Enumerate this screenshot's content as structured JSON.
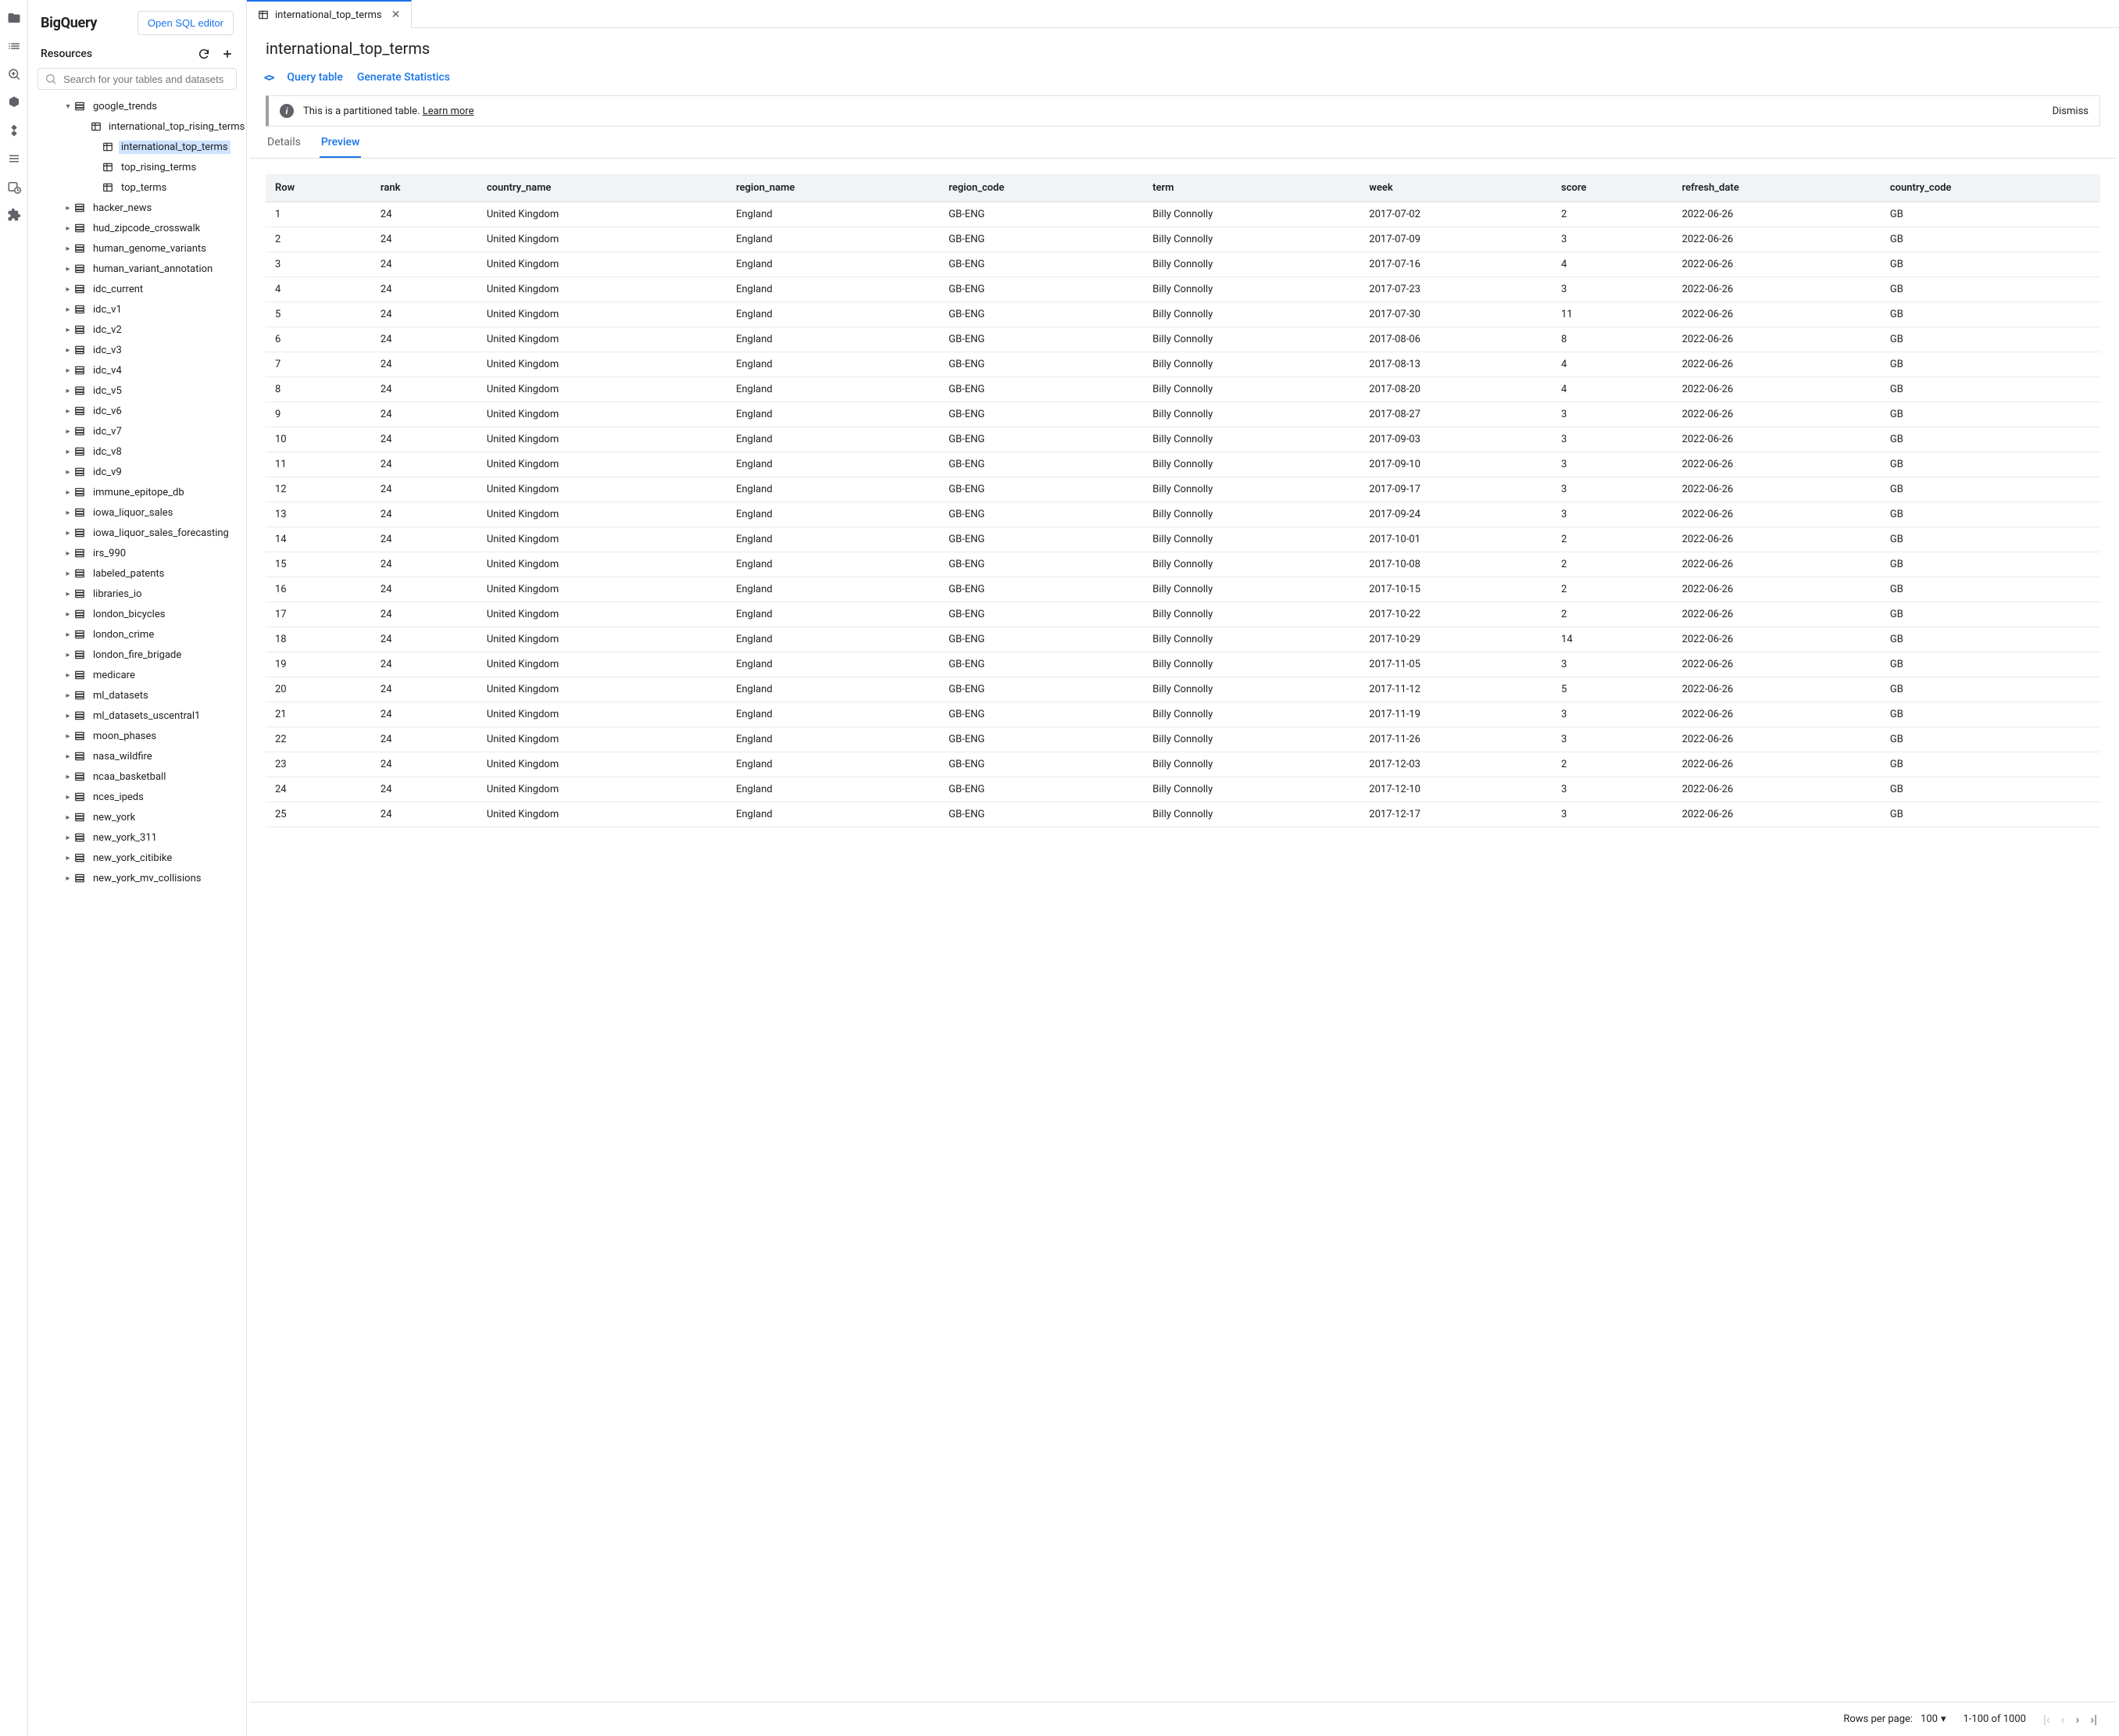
{
  "brand": "BigQuery",
  "open_editor_label": "Open SQL editor",
  "resources_label": "Resources",
  "search_placeholder": "Search for your tables and datasets",
  "tree": {
    "root": {
      "label": "google_trends",
      "expanded": true
    },
    "root_children": [
      {
        "label": "international_top_rising_terms",
        "selected": false
      },
      {
        "label": "international_top_terms",
        "selected": true
      },
      {
        "label": "top_rising_terms",
        "selected": false
      },
      {
        "label": "top_terms",
        "selected": false
      }
    ],
    "datasets": [
      "hacker_news",
      "hud_zipcode_crosswalk",
      "human_genome_variants",
      "human_variant_annotation",
      "idc_current",
      "idc_v1",
      "idc_v2",
      "idc_v3",
      "idc_v4",
      "idc_v5",
      "idc_v6",
      "idc_v7",
      "idc_v8",
      "idc_v9",
      "immune_epitope_db",
      "iowa_liquor_sales",
      "iowa_liquor_sales_forecasting",
      "irs_990",
      "labeled_patents",
      "libraries_io",
      "london_bicycles",
      "london_crime",
      "london_fire_brigade",
      "medicare",
      "ml_datasets",
      "ml_datasets_uscentral1",
      "moon_phases",
      "nasa_wildfire",
      "ncaa_basketball",
      "nces_ipeds",
      "new_york",
      "new_york_311",
      "new_york_citibike",
      "new_york_mv_collisions"
    ]
  },
  "tab_label": "international_top_terms",
  "page_title": "international_top_terms",
  "actions": {
    "query_table": "Query table",
    "generate_stats": "Generate Statistics"
  },
  "banner": {
    "text": "This is a partitioned table.",
    "link": "Learn more",
    "dismiss": "Dismiss"
  },
  "subtabs": {
    "details": "Details",
    "preview": "Preview"
  },
  "table": {
    "columns": [
      "Row",
      "rank",
      "country_name",
      "region_name",
      "region_code",
      "term",
      "week",
      "score",
      "refresh_date",
      "country_code"
    ],
    "rows": [
      [
        "1",
        "24",
        "United Kingdom",
        "England",
        "GB-ENG",
        "Billy Connolly",
        "2017-07-02",
        "2",
        "2022-06-26",
        "GB"
      ],
      [
        "2",
        "24",
        "United Kingdom",
        "England",
        "GB-ENG",
        "Billy Connolly",
        "2017-07-09",
        "3",
        "2022-06-26",
        "GB"
      ],
      [
        "3",
        "24",
        "United Kingdom",
        "England",
        "GB-ENG",
        "Billy Connolly",
        "2017-07-16",
        "4",
        "2022-06-26",
        "GB"
      ],
      [
        "4",
        "24",
        "United Kingdom",
        "England",
        "GB-ENG",
        "Billy Connolly",
        "2017-07-23",
        "3",
        "2022-06-26",
        "GB"
      ],
      [
        "5",
        "24",
        "United Kingdom",
        "England",
        "GB-ENG",
        "Billy Connolly",
        "2017-07-30",
        "11",
        "2022-06-26",
        "GB"
      ],
      [
        "6",
        "24",
        "United Kingdom",
        "England",
        "GB-ENG",
        "Billy Connolly",
        "2017-08-06",
        "8",
        "2022-06-26",
        "GB"
      ],
      [
        "7",
        "24",
        "United Kingdom",
        "England",
        "GB-ENG",
        "Billy Connolly",
        "2017-08-13",
        "4",
        "2022-06-26",
        "GB"
      ],
      [
        "8",
        "24",
        "United Kingdom",
        "England",
        "GB-ENG",
        "Billy Connolly",
        "2017-08-20",
        "4",
        "2022-06-26",
        "GB"
      ],
      [
        "9",
        "24",
        "United Kingdom",
        "England",
        "GB-ENG",
        "Billy Connolly",
        "2017-08-27",
        "3",
        "2022-06-26",
        "GB"
      ],
      [
        "10",
        "24",
        "United Kingdom",
        "England",
        "GB-ENG",
        "Billy Connolly",
        "2017-09-03",
        "3",
        "2022-06-26",
        "GB"
      ],
      [
        "11",
        "24",
        "United Kingdom",
        "England",
        "GB-ENG",
        "Billy Connolly",
        "2017-09-10",
        "3",
        "2022-06-26",
        "GB"
      ],
      [
        "12",
        "24",
        "United Kingdom",
        "England",
        "GB-ENG",
        "Billy Connolly",
        "2017-09-17",
        "3",
        "2022-06-26",
        "GB"
      ],
      [
        "13",
        "24",
        "United Kingdom",
        "England",
        "GB-ENG",
        "Billy Connolly",
        "2017-09-24",
        "3",
        "2022-06-26",
        "GB"
      ],
      [
        "14",
        "24",
        "United Kingdom",
        "England",
        "GB-ENG",
        "Billy Connolly",
        "2017-10-01",
        "2",
        "2022-06-26",
        "GB"
      ],
      [
        "15",
        "24",
        "United Kingdom",
        "England",
        "GB-ENG",
        "Billy Connolly",
        "2017-10-08",
        "2",
        "2022-06-26",
        "GB"
      ],
      [
        "16",
        "24",
        "United Kingdom",
        "England",
        "GB-ENG",
        "Billy Connolly",
        "2017-10-15",
        "2",
        "2022-06-26",
        "GB"
      ],
      [
        "17",
        "24",
        "United Kingdom",
        "England",
        "GB-ENG",
        "Billy Connolly",
        "2017-10-22",
        "2",
        "2022-06-26",
        "GB"
      ],
      [
        "18",
        "24",
        "United Kingdom",
        "England",
        "GB-ENG",
        "Billy Connolly",
        "2017-10-29",
        "14",
        "2022-06-26",
        "GB"
      ],
      [
        "19",
        "24",
        "United Kingdom",
        "England",
        "GB-ENG",
        "Billy Connolly",
        "2017-11-05",
        "3",
        "2022-06-26",
        "GB"
      ],
      [
        "20",
        "24",
        "United Kingdom",
        "England",
        "GB-ENG",
        "Billy Connolly",
        "2017-11-12",
        "5",
        "2022-06-26",
        "GB"
      ],
      [
        "21",
        "24",
        "United Kingdom",
        "England",
        "GB-ENG",
        "Billy Connolly",
        "2017-11-19",
        "3",
        "2022-06-26",
        "GB"
      ],
      [
        "22",
        "24",
        "United Kingdom",
        "England",
        "GB-ENG",
        "Billy Connolly",
        "2017-11-26",
        "3",
        "2022-06-26",
        "GB"
      ],
      [
        "23",
        "24",
        "United Kingdom",
        "England",
        "GB-ENG",
        "Billy Connolly",
        "2017-12-03",
        "2",
        "2022-06-26",
        "GB"
      ],
      [
        "24",
        "24",
        "United Kingdom",
        "England",
        "GB-ENG",
        "Billy Connolly",
        "2017-12-10",
        "3",
        "2022-06-26",
        "GB"
      ],
      [
        "25",
        "24",
        "United Kingdom",
        "England",
        "GB-ENG",
        "Billy Connolly",
        "2017-12-17",
        "3",
        "2022-06-26",
        "GB"
      ]
    ]
  },
  "pager": {
    "rows_label": "Rows per page:",
    "rows_value": "100",
    "range": "1-100 of 1000"
  }
}
